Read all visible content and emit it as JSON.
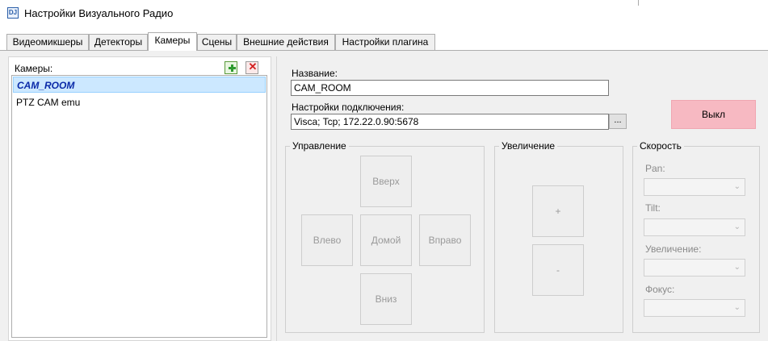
{
  "window": {
    "title": "Настройки Визуального Радио",
    "icon": "app-icon",
    "icon_text": "DJ"
  },
  "tabs": [
    {
      "label": "Видеомикшеры",
      "active": false
    },
    {
      "label": "Детекторы",
      "active": false
    },
    {
      "label": "Камеры",
      "active": true
    },
    {
      "label": "Сцены",
      "active": false
    },
    {
      "label": "Внешние действия",
      "active": false
    },
    {
      "label": "Настройки плагина",
      "active": false
    }
  ],
  "cameras": {
    "label": "Камеры:",
    "add_icon": "add-icon",
    "delete_icon": "delete-icon",
    "delete_glyph": "✕",
    "items": [
      {
        "label": "CAM_ROOM",
        "selected": true
      },
      {
        "label": "PTZ CAM emu",
        "selected": false
      }
    ]
  },
  "details": {
    "name_label": "Название:",
    "name_value": "CAM_ROOM",
    "connection_label": "Настройки подключения:",
    "connection_value": "Visca; Tcp; 172.22.0.90:5678",
    "browse_label": "...",
    "off_button": "Выкл"
  },
  "control": {
    "title": "Управление",
    "up": "Вверх",
    "left": "Влево",
    "home": "Домой",
    "right": "Вправо",
    "down": "Вниз"
  },
  "zoom": {
    "title": "Увеличение",
    "plus": "+",
    "minus": "-"
  },
  "speed": {
    "title": "Скорость",
    "pan_label": "Pan:",
    "tilt_label": "Tilt:",
    "zoom_label": "Увеличение:",
    "focus_label": "Фокус:",
    "chevron": "⌄"
  },
  "colors": {
    "selection_bg": "#cce8ff",
    "selection_text": "#0a2aa8",
    "off_button_bg": "#f7b9c2",
    "panel_bg": "#f0f0f0"
  }
}
